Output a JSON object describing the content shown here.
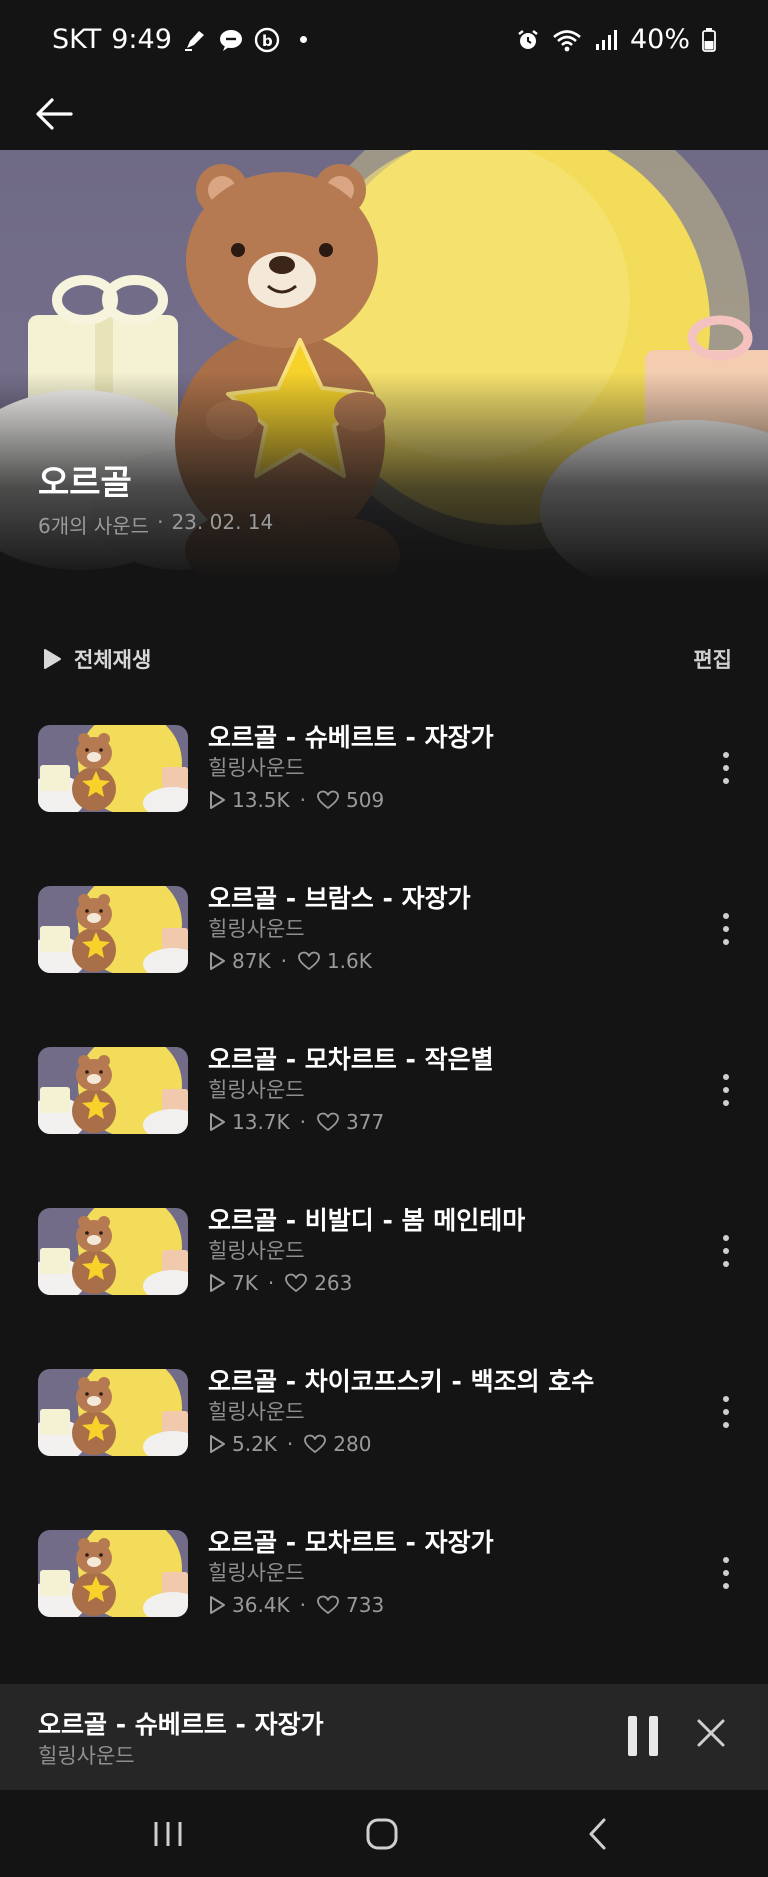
{
  "status_bar": {
    "carrier": "SKT",
    "time": "9:49",
    "battery": "40%",
    "icons_left": [
      "pen-icon",
      "chat-bubble-icon",
      "b-app-icon",
      "notification-dot"
    ],
    "icons_right": [
      "alarm-icon",
      "wifi-icon",
      "signal-icon",
      "battery-icon"
    ]
  },
  "header": {
    "back_icon": "arrow-left-icon"
  },
  "playlist": {
    "title": "오르골",
    "count": "6개의 사운드",
    "separator": "·",
    "date": "23. 02. 14"
  },
  "actions": {
    "play_all": "전체재생",
    "edit": "편집"
  },
  "tracks": [
    {
      "title": "오르골 - 슈베르트 - 자장가",
      "artist": "힐링사운드",
      "plays": "13.5K",
      "likes": "509"
    },
    {
      "title": "오르골 - 브람스 - 자장가",
      "artist": "힐링사운드",
      "plays": "87K",
      "likes": "1.6K"
    },
    {
      "title": "오르골 - 모차르트 - 작은별",
      "artist": "힐링사운드",
      "plays": "13.7K",
      "likes": "377"
    },
    {
      "title": "오르골 - 비발디 - 봄 메인테마",
      "artist": "힐링사운드",
      "plays": "7K",
      "likes": "263"
    },
    {
      "title": "오르골 - 차이코프스키 - 백조의 호수",
      "artist": "힐링사운드",
      "plays": "5.2K",
      "likes": "280"
    },
    {
      "title": "오르골 - 모차르트 - 자장가",
      "artist": "힐링사운드",
      "plays": "36.4K",
      "likes": "733"
    }
  ],
  "player": {
    "title": "오르골 - 슈베르트 - 자장가",
    "artist": "힐링사운드"
  },
  "colors": {
    "background": "#141414",
    "player_bg": "#262626",
    "secondary_text": "#8f8f8f",
    "moon": "#f3dc5a",
    "bear": "#b57a52",
    "star": "#f6d22b"
  }
}
